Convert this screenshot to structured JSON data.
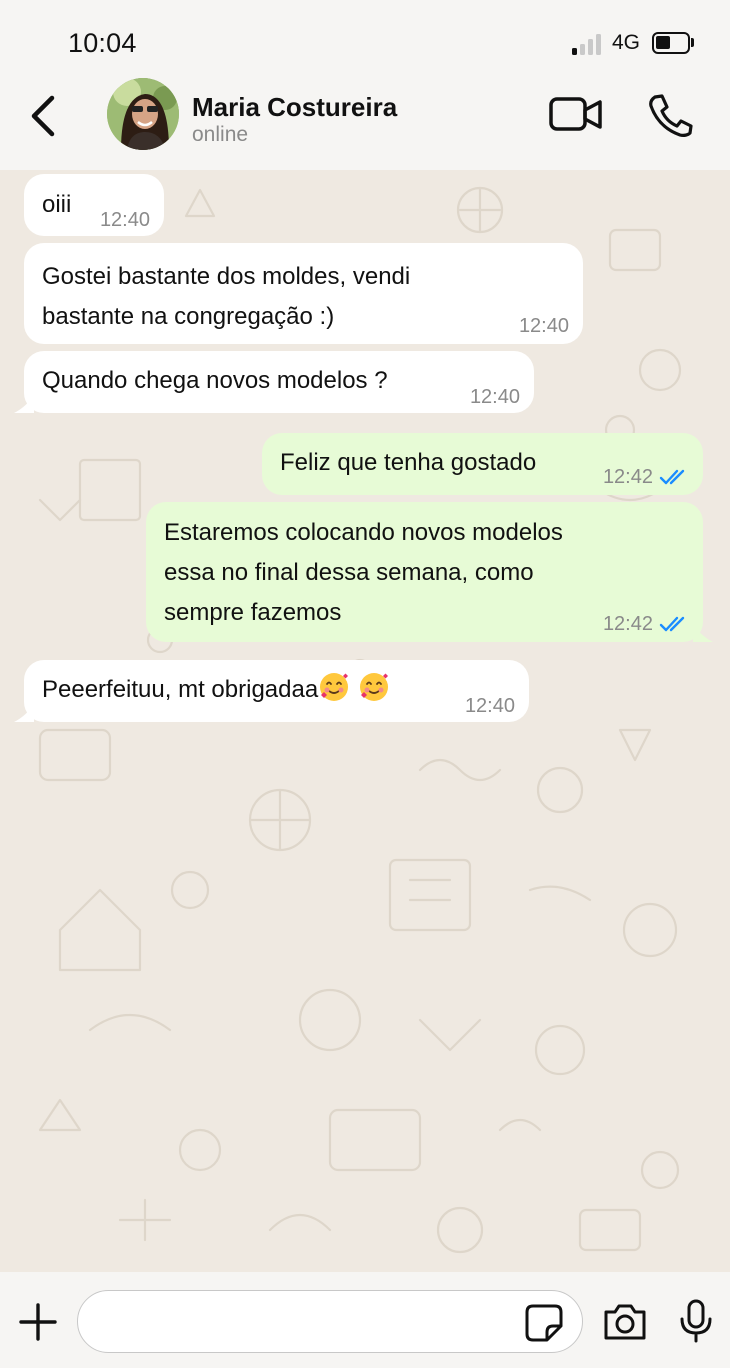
{
  "status_bar": {
    "time": "10:04",
    "network": "4G",
    "signal_bars_active": 1,
    "signal_bars_total": 4,
    "battery_level": 0.45
  },
  "header": {
    "contact_name": "Maria Costureira",
    "contact_status": "online",
    "icons": [
      "chevron-left-icon",
      "avatar",
      "video-camera-icon",
      "phone-icon"
    ]
  },
  "messages": [
    {
      "direction": "in",
      "text": "oiii",
      "time": "12:40"
    },
    {
      "direction": "in",
      "text": "Gostei bastante dos moldes, vendi bastante na congregação :)",
      "line1": "Gostei bastante dos moldes, vendi",
      "line2": "bastante na congregação :)",
      "time": "12:40"
    },
    {
      "direction": "in",
      "text": "Quando chega novos modelos ?",
      "time": "12:40"
    },
    {
      "direction": "out",
      "text": "Feliz que tenha gostado",
      "time": "12:42",
      "status": "read"
    },
    {
      "direction": "out",
      "text": "Estaremos colocando novos modelos essa no final dessa semana, como sempre fazemos",
      "line1": "Estaremos colocando novos modelos",
      "line2": "essa no final dessa semana, como",
      "line3": "sempre fazemos",
      "time": "12:42",
      "status": "read"
    },
    {
      "direction": "in",
      "text": "Peeerfeituu, mt obrigadaa",
      "emoji": "smiling-face-with-hearts",
      "time": "12:40"
    }
  ],
  "composer": {
    "placeholder": "",
    "value": "",
    "icons": [
      "plus-icon",
      "sticker-icon",
      "camera-icon",
      "microphone-icon"
    ]
  },
  "colors": {
    "incoming_bubble": "#ffffff",
    "outgoing_bubble": "#e7fbd6",
    "read_ticks": "#1a8cff",
    "chat_background": "#efe9e1",
    "header_background": "#f6f5f3"
  }
}
